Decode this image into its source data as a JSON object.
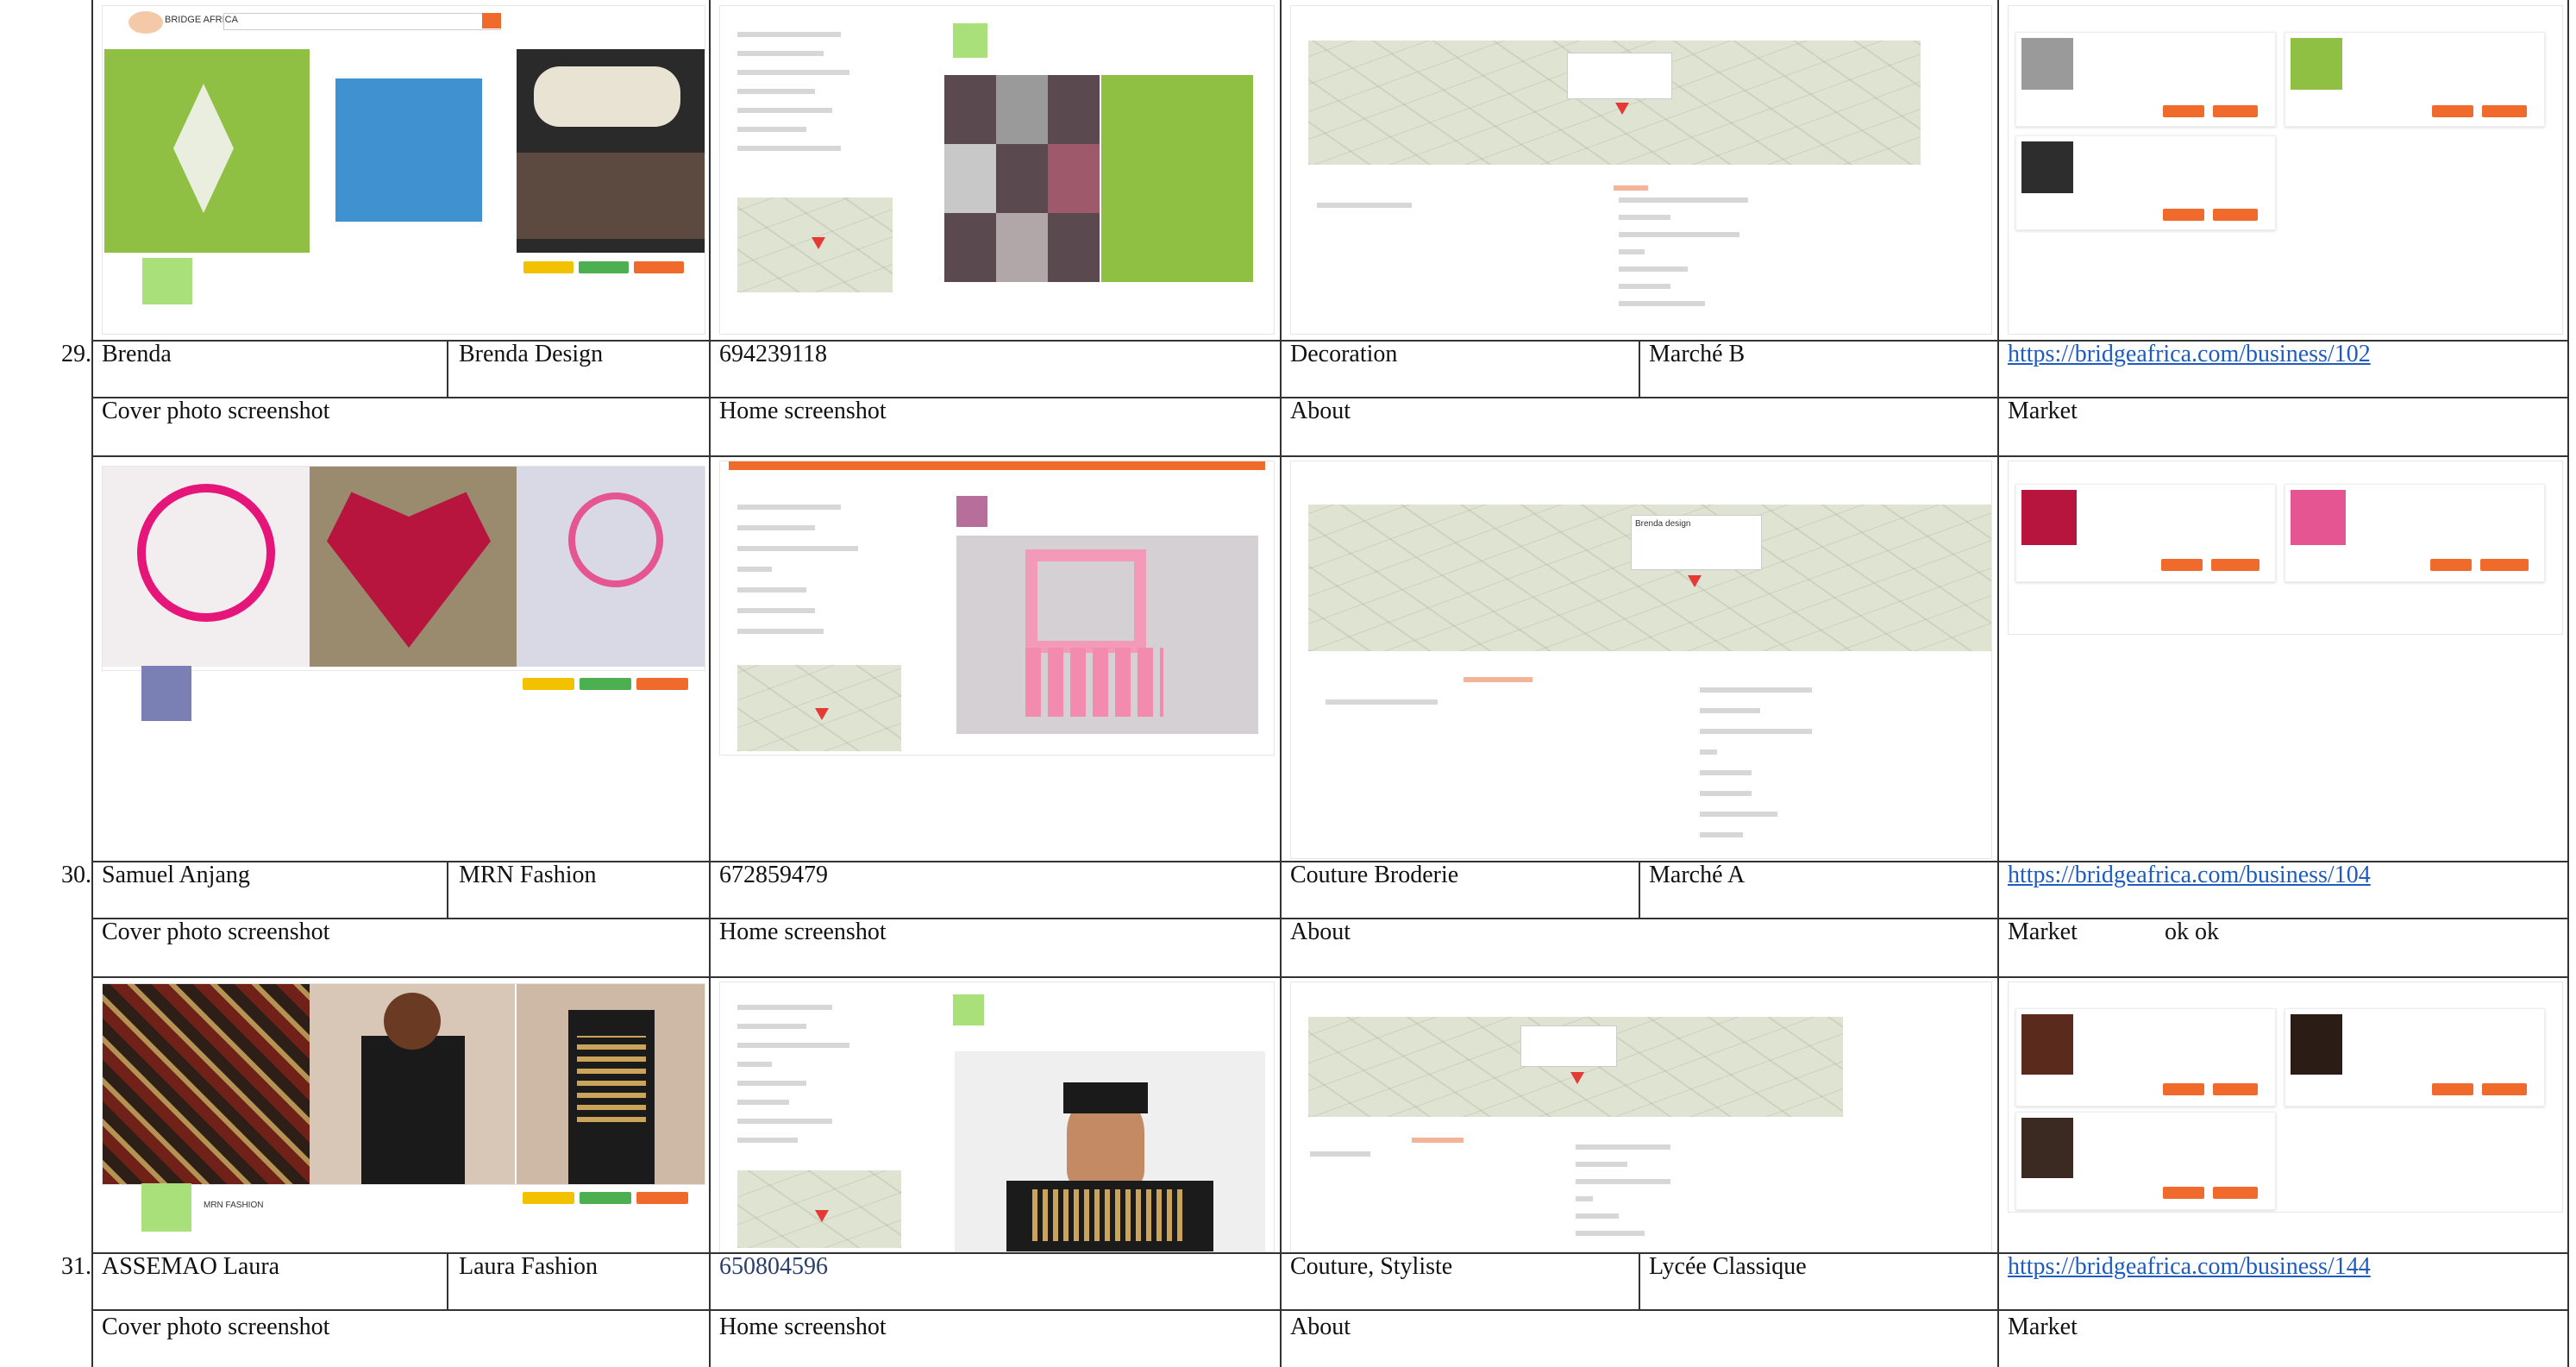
{
  "rows": [
    {
      "num": "29.",
      "owner": "Brenda",
      "business": "Brenda Design",
      "phone": "694239118",
      "category": "Decoration",
      "location": "Marché B",
      "url": "https://bridgeafrica.com/business/102",
      "labels": {
        "cover": "Cover photo screenshot",
        "home": "Home screenshot",
        "about": "About",
        "market": "Market",
        "note": ""
      }
    },
    {
      "num": "30.",
      "owner": "Samuel Anjang",
      "business": "MRN Fashion",
      "phone": "672859479",
      "category": "Couture Broderie",
      "location": "Marché A",
      "url": "https://bridgeafrica.com/business/104",
      "labels": {
        "cover": "Cover photo screenshot",
        "home": "Home screenshot",
        "about": "About",
        "market": "Market",
        "note": "ok ok"
      }
    },
    {
      "num": "31.",
      "owner": "ASSEMAO Laura",
      "business": "Laura Fashion",
      "phone": "650804596",
      "category": "Couture, Styliste",
      "location": "Lycée Classique",
      "url": "https://bridgeafrica.com/business/144",
      "labels": {
        "cover": "Cover photo screenshot",
        "home": "Home screenshot",
        "about": "About",
        "market": "Market",
        "note": ""
      }
    }
  ],
  "thumbs": {
    "top_cover_brand": "BRIDGE AFRICA",
    "brenda_callout": "Brenda design",
    "mrn_profile": "MRN FASHION"
  },
  "colors": {
    "accent": "#f06a2b",
    "link": "#1f5cbf",
    "rule": "#333333"
  },
  "icons": [
    "map-pin-icon",
    "location-icon",
    "phone-icon",
    "mail-icon",
    "globe-icon"
  ]
}
